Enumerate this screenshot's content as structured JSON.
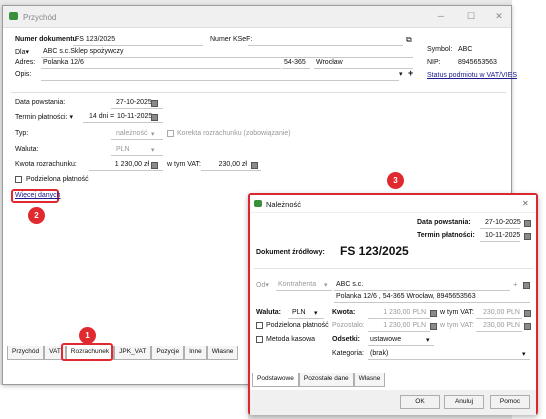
{
  "main_window": {
    "title": "Przychód",
    "doc_number_label": "Numer dokumentu",
    "doc_number": "FS 123/2025",
    "ksef_label": "Numer KSeF:",
    "dla_label": "Dla",
    "dla_value": "ABC s.c.Sklep spożywczy",
    "adres_label": "Adres:",
    "street": "Polanka  12/6",
    "postcode": "54-365",
    "city": "Wrocław",
    "opis_label": "Opis:",
    "symbol_label": "Symbol:",
    "symbol_value": "ABC",
    "nip_label": "NIP:",
    "nip_value": "8945653563",
    "vat_status_link": "Status podmiotu w VAT/VIES",
    "data_powstania_label": "Data powstania:",
    "data_powstania": "27-10-2025",
    "termin_label": "Termin płatności:",
    "termin_dni": "14 dni",
    "termin_eq": "=",
    "termin_date": "10-11-2025",
    "typ_label": "Typ:",
    "typ_value": "należność",
    "korekta_label": "Korekta rozrachunku (zobowiązanie)",
    "waluta_label": "Waluta:",
    "waluta_value": "PLN",
    "kwota_label": "Kwota rozrachunku:",
    "kwota_value": "1 230,00 zł",
    "vat_label": "w tym VAT:",
    "vat_value": "230,00 zł",
    "podzielona_label": "Podzielona płatność",
    "wiecej_link": "Więcej danych",
    "tabs": [
      "Przychód",
      "VAT",
      "Rozrachunek",
      "JPK_VAT",
      "Pozycje",
      "Inne",
      "Własne"
    ],
    "active_tab": "Rozrachunek"
  },
  "dialog": {
    "title": "Należność",
    "data_powstania_label": "Data powstania:",
    "data_powstania": "27-10-2025",
    "termin_label": "Termin płatności:",
    "termin_date": "10-11-2025",
    "dok_label": "Dokument źródłowy:",
    "dok_value": "FS 123/2025",
    "od_label": "Od",
    "kontrahenta": "Kontrahenta",
    "kontrahent_name": "ABC s.c.",
    "kontrahent_addr": "Polanka  12/6 , 54-365 Wrocław, 8945653563",
    "waluta_label": "Waluta:",
    "waluta_value": "PLN",
    "kwota_label": "Kwota:",
    "kwota_value": "1 230,00 PLN",
    "vat_label": "w tym VAT:",
    "vat_value": "230,00 PLN",
    "pozostalo_label": "Pozostało:",
    "pozostalo_value": "1 230,00 PLN",
    "pozostalo_vat_label": "w tym VAT:",
    "pozostalo_vat_value": "230,00 PLN",
    "podzielona_label": "Podzielona płatność",
    "odsetki_label": "Odsetki:",
    "odsetki_value": "ustawowe",
    "metoda_label": "Metoda kasowa",
    "kategoria_label": "Kategoria:",
    "kategoria_value": "(brak)",
    "tabs": [
      "Podstawowe",
      "Pozostałe dane",
      "Własne"
    ],
    "ok": "OK",
    "anuluj": "Anuluj",
    "pomoc": "Pomoc"
  },
  "badges": [
    "1",
    "2",
    "3"
  ],
  "colors": {
    "highlight": "#e02a2f",
    "link": "#1a1a8c"
  }
}
